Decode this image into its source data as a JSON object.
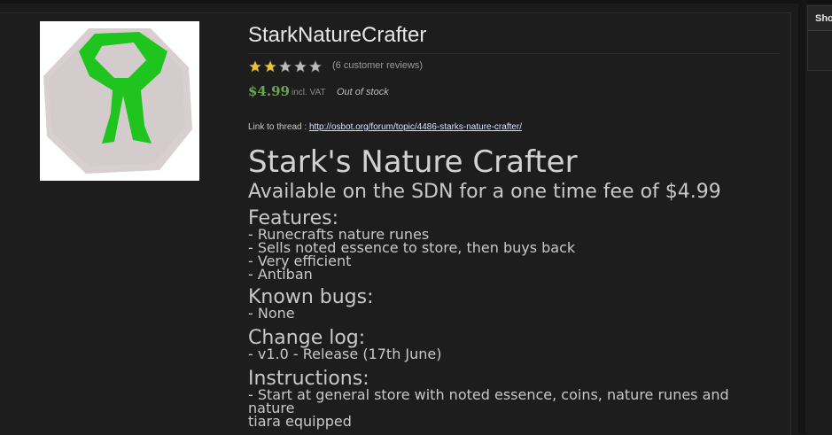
{
  "sidebar": {
    "title": "Shop"
  },
  "product": {
    "image_icon": "nature-rune-icon",
    "title": "StarkNatureCrafter",
    "rating_stars": 2,
    "rating_max": 5,
    "reviews_text": "(6 customer reviews)",
    "price": "$4.99",
    "vat_text": "incl. VAT",
    "stock_text": "Out of stock",
    "thread_label": "Link to thread :",
    "thread_url": "http://osbot.org/forum/topic/4486-starks-nature-crafter/"
  },
  "description": {
    "heading": "Stark's Nature Crafter",
    "subheading": "Available on the SDN for a one time fee of $4.99",
    "features_title": "Features:",
    "features": [
      "- Runecrafts nature runes",
      "- Sells noted essence to store, then buys back",
      "- Very efficient",
      "- Antiban"
    ],
    "bugs_title": "Known bugs:",
    "bugs": [
      "- None"
    ],
    "changelog_title": "Change log:",
    "changelog": [
      "- v1.0 - Release (17th June)"
    ],
    "instructions_title": "Instructions:",
    "instructions": [
      "- Start at general store with noted essence, coins, nature runes and nature",
      "tiara equipped"
    ]
  },
  "colors": {
    "background": "#1b1b1b",
    "price": "#6aa84f",
    "star_filled": "#f2c12e",
    "star_empty": "#bcbcbc",
    "rune_green": "#1fc41f"
  }
}
